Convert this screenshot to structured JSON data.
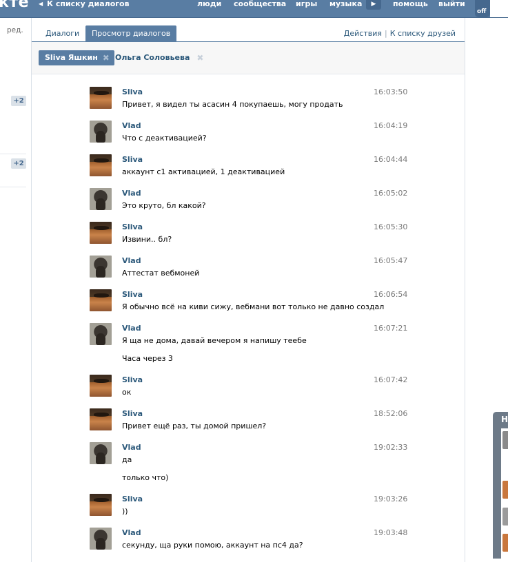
{
  "topbar": {
    "brand": "кте",
    "back_label": "К списку диалогов",
    "nav": [
      "люди",
      "сообщества",
      "игры",
      "музыка"
    ],
    "help": "помощь",
    "logout": "выйти",
    "off": "off"
  },
  "left": {
    "edit_link": "ред.",
    "badges": [
      "+2",
      "+2"
    ]
  },
  "tabs": {
    "dialogs": "Диалоги",
    "view": "Просмотр диалогов",
    "actions": "Действия",
    "separator": "|",
    "to_friends": "К списку друзей"
  },
  "peers": [
    {
      "name": "Sliva Яшкин",
      "close": "✖"
    },
    {
      "name": "Ольга Соловьева",
      "close": "✖"
    }
  ],
  "messages": [
    {
      "author": "Sliva",
      "time": "16:03:50",
      "lines": [
        "Привет, я видел ты асасин 4 покупаешь, могу продать"
      ]
    },
    {
      "author": "Vlad",
      "time": "16:04:19",
      "lines": [
        "Что с деактивацией?"
      ]
    },
    {
      "author": "Sliva",
      "time": "16:04:44",
      "lines": [
        "аккаунт с1 активацией, 1 деактивацией"
      ]
    },
    {
      "author": "Vlad",
      "time": "16:05:02",
      "lines": [
        "Это круто, бл какой?"
      ]
    },
    {
      "author": "Sliva",
      "time": "16:05:30",
      "lines": [
        "Извини.. бл?"
      ]
    },
    {
      "author": "Vlad",
      "time": "16:05:47",
      "lines": [
        "Аттестат вебмоней"
      ]
    },
    {
      "author": "Sliva",
      "time": "16:06:54",
      "lines": [
        "Я обычно всё на киви сижу, вебмани вот только не давно создал"
      ]
    },
    {
      "author": "Vlad",
      "time": "16:07:21",
      "lines": [
        "Я ща не дома, давай вечером я напишу теебе",
        "Часа через 3"
      ]
    },
    {
      "author": "Sliva",
      "time": "16:07:42",
      "lines": [
        "ок"
      ]
    },
    {
      "author": "Sliva",
      "time": "18:52:06",
      "lines": [
        "Привет ещё раз, ты домой пришел?"
      ]
    },
    {
      "author": "Vlad",
      "time": "19:02:33",
      "lines": [
        "да",
        "только что)"
      ]
    },
    {
      "author": "Sliva",
      "time": "19:03:26",
      "lines": [
        "))"
      ]
    },
    {
      "author": "Vlad",
      "time": "19:03:48",
      "lines": [
        "секунду, ща руки помою, аккаунт на пс4 да?"
      ]
    }
  ],
  "float_panel": {
    "heading": "Н"
  }
}
